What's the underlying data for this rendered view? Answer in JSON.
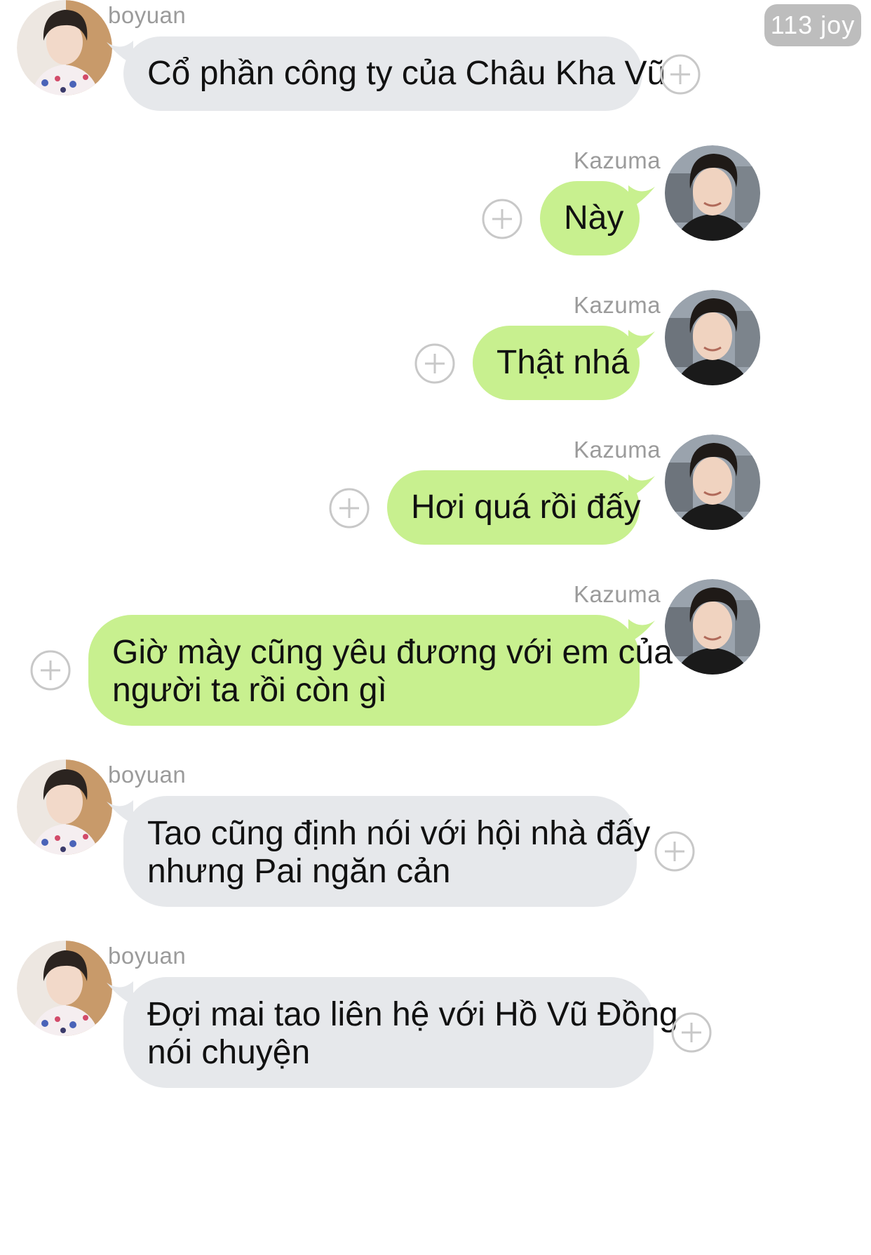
{
  "counter_badge": "113 joy",
  "messages": [
    {
      "sender": "boyuan",
      "side": "left",
      "lines": [
        "Cổ phần công ty của Châu Kha Vũ"
      ]
    },
    {
      "sender": "Kazuma",
      "side": "right",
      "lines": [
        "Này"
      ]
    },
    {
      "sender": "Kazuma",
      "side": "right",
      "lines": [
        "Thật nhá"
      ]
    },
    {
      "sender": "Kazuma",
      "side": "right",
      "lines": [
        "Hơi quá rồi đấy"
      ]
    },
    {
      "sender": "Kazuma",
      "side": "right",
      "lines": [
        "Giờ mày cũng yêu đương với em của",
        "người ta rồi còn gì"
      ]
    },
    {
      "sender": "boyuan",
      "side": "left",
      "lines": [
        "Tao cũng định nói với hội nhà đấy",
        "nhưng Pai ngăn cản"
      ]
    },
    {
      "sender": "boyuan",
      "side": "left",
      "lines": [
        "Đợi mai tao liên hệ với Hồ Vũ Đồng",
        "nói chuyện"
      ]
    }
  ],
  "colors": {
    "incoming_bubble": "#e6e8eb",
    "outgoing_bubble": "#c8f08f",
    "badge": "#bdbdbd"
  },
  "icons": {
    "reaction": "add-reaction-icon",
    "avatar_boyuan": "avatar",
    "avatar_kazuma": "avatar"
  }
}
